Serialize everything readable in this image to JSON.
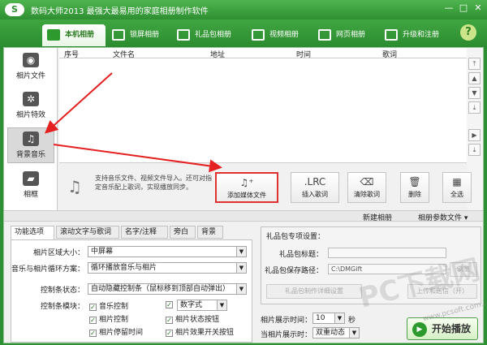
{
  "app": {
    "logo": "S",
    "title": "数码大师2013   最强大最易用的家庭相册制作软件",
    "min": "—",
    "max": "□",
    "close": "✕"
  },
  "nav_tabs": [
    {
      "label": "本机相册"
    },
    {
      "label": "锁屏相册"
    },
    {
      "label": "礼品包相册"
    },
    {
      "label": "视频相册"
    },
    {
      "label": "网页相册"
    },
    {
      "label": "升级和注册"
    }
  ],
  "help": "?",
  "sidebar": [
    {
      "label": "相片文件",
      "icon": "camera-icon"
    },
    {
      "label": "相片特效",
      "icon": "effects-icon"
    },
    {
      "label": "背景音乐",
      "icon": "music-note-icon"
    },
    {
      "label": "相框",
      "icon": "frame-icon"
    }
  ],
  "table": {
    "columns": [
      "序号",
      "文件名",
      "地址",
      "时间",
      "歌词"
    ]
  },
  "hint": "支持音乐文件、视频文件导入。还可对指定音乐配上歌词，实现播放同步。",
  "toolbar": [
    {
      "label": "添加媒体文件",
      "icon": "♫⁺"
    },
    {
      "label": "插入歌词",
      "icon": ".LRC"
    },
    {
      "label": "清除歌词",
      "icon": "⌫"
    },
    {
      "label": "删除",
      "icon": "🗑"
    },
    {
      "label": "全选",
      "icon": "▦"
    }
  ],
  "secbar": {
    "new_album": "新建相册",
    "album_params": "相册参数文件 ▾"
  },
  "tabs2": [
    "功能选项",
    "滚动文字与歌词",
    "名字/注释",
    "旁白",
    "背景"
  ],
  "options": {
    "area_size_label": "相片区域大小：",
    "area_size": "中屏幕",
    "loop_label": "音乐与相片循环方案：",
    "loop": "循环播放音乐与相片",
    "control_label": "控制条状态：",
    "control": "自动隐藏控制条（鼠标移到顶部自动弹出）",
    "module_label": "控制条模块：",
    "modules": [
      "音乐控制",
      "相片控制",
      "相片停留时间",
      "数字式",
      "相片状态按钮",
      "相片效果开关按钮"
    ]
  },
  "gift": {
    "title": "礼品包专项设置：",
    "name_label": "礼品包标题：",
    "path_label": "礼品包保存路径：",
    "path": "C:\\DMGift",
    "browse": "浏览",
    "detail": "礼品包制作详细设置",
    "upload": "上传和送信（开）"
  },
  "display": {
    "count_label": "相片展示时间：",
    "count": "10",
    "seconds": "秒",
    "effect_label": "当相片展示时：",
    "effect": "双重动态"
  },
  "start": "开始播放",
  "watermark": {
    "text": "PC下载网",
    "url": "www.pcsoft.com.cn"
  }
}
